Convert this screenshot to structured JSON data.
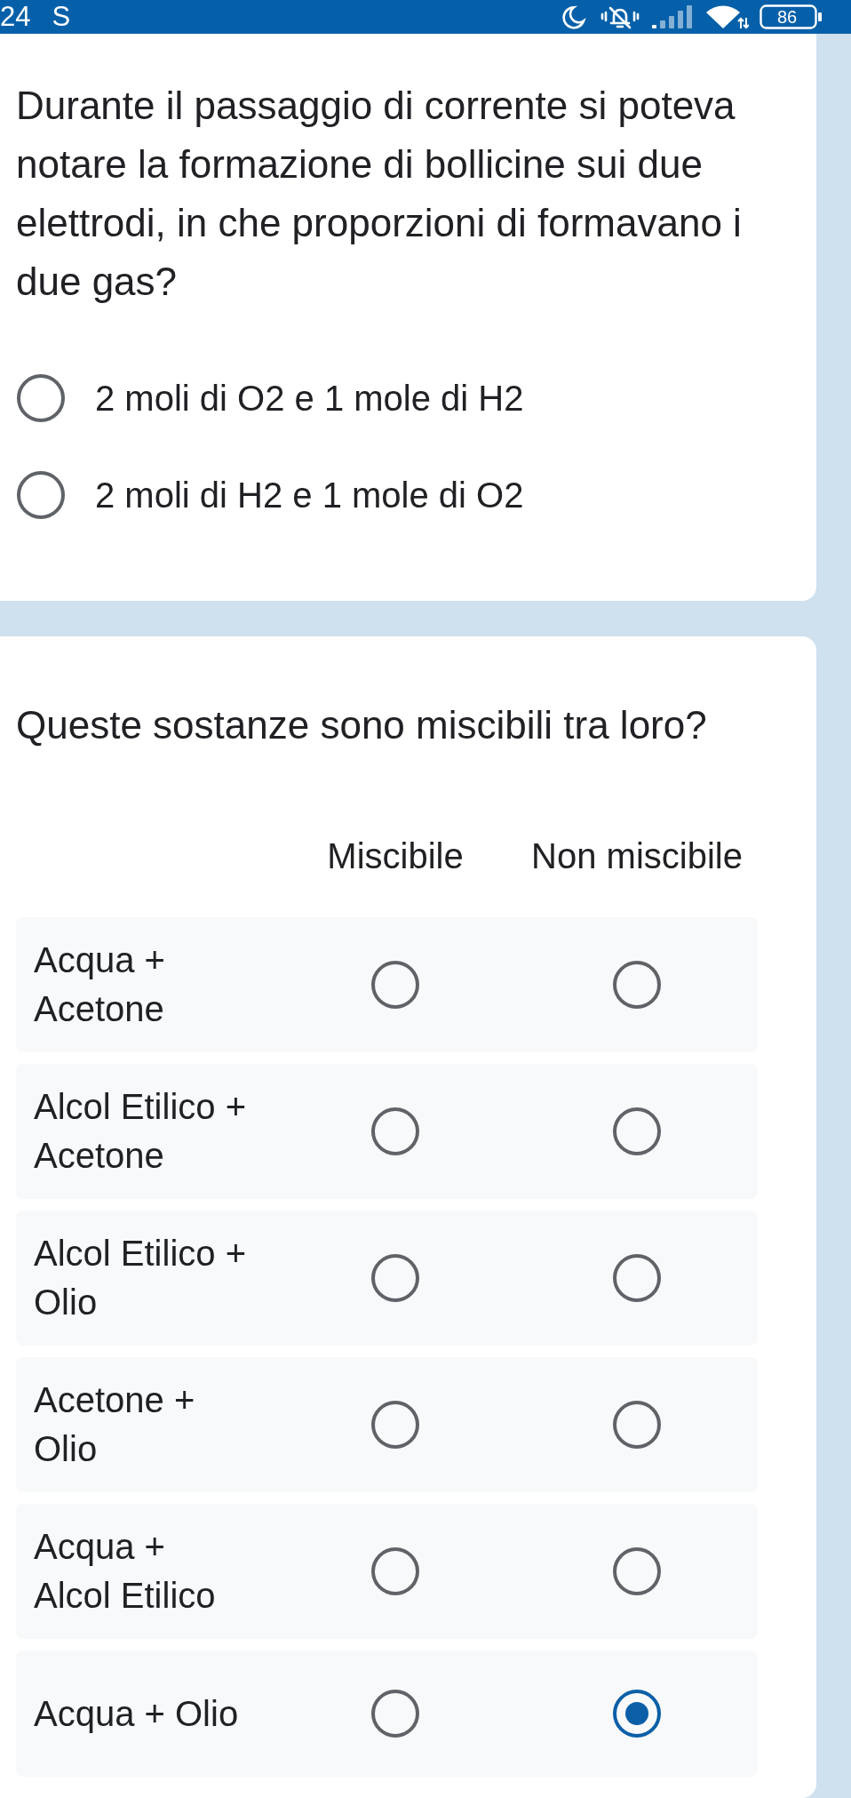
{
  "status_bar": {
    "time": "24",
    "notification": "S",
    "battery": "86"
  },
  "questions": [
    {
      "kind": "choice",
      "title": "Durante il passaggio di corrente si poteva notare la formazione di bollicine sui due elettrodi, in che proporzioni di formavano i due gas?",
      "options": [
        {
          "label": "2 moli di O2 e 1 mole di H2",
          "selected": false
        },
        {
          "label": "2 moli di H2 e 1 mole di O2",
          "selected": false
        }
      ]
    },
    {
      "kind": "grid",
      "title": "Queste sostanze sono miscibili tra loro?",
      "columns": [
        "Miscibile",
        "Non miscibile"
      ],
      "rows": [
        {
          "label": "Acqua + Acetone",
          "cells": [
            {
              "selected": false
            },
            {
              "selected": false
            }
          ]
        },
        {
          "label": "Alcol Etilico + Acetone",
          "cells": [
            {
              "selected": false
            },
            {
              "selected": false
            }
          ]
        },
        {
          "label": "Alcol Etilico + Olio",
          "cells": [
            {
              "selected": false
            },
            {
              "selected": false
            }
          ]
        },
        {
          "label": "Acetone + Olio",
          "cells": [
            {
              "selected": false
            },
            {
              "selected": false
            }
          ]
        },
        {
          "label": "Acqua + Alcol Etilico",
          "cells": [
            {
              "selected": false
            },
            {
              "selected": false
            }
          ]
        },
        {
          "label": "Acqua + Olio",
          "cells": [
            {
              "selected": false
            },
            {
              "selected": true
            }
          ]
        }
      ]
    }
  ]
}
